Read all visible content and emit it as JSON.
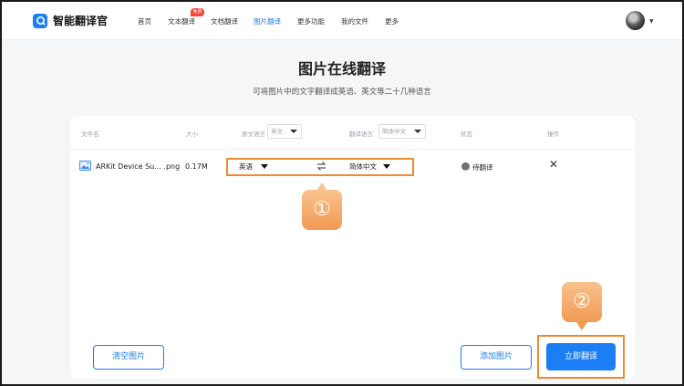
{
  "header": {
    "logo_text": "智能翻译官",
    "nav": [
      {
        "label": "首页",
        "active": false
      },
      {
        "label": "文本翻译",
        "active": false
      },
      {
        "label": "文档翻译",
        "active": false
      },
      {
        "label": "图片翻译",
        "active": true
      },
      {
        "label": "更多功能",
        "active": false
      },
      {
        "label": "我的文件",
        "active": false
      },
      {
        "label": "更多",
        "active": false
      }
    ],
    "badge": "免费",
    "accent": "#1b7ef5"
  },
  "page": {
    "title": "图片在线翻译",
    "subtitle": "可将图片中的文字翻译成英语、英文等二十几种语言"
  },
  "table": {
    "headers": {
      "file_name": "文件名",
      "size": "大小",
      "source_lang": "原文语言",
      "source_select": "英文",
      "target_lang": "翻译语言",
      "target_select": "简体中文",
      "status": "状态",
      "action": "操作"
    },
    "rows": [
      {
        "file_name": "ARKit Device Su... .png",
        "size": "0.17M",
        "source": "英语",
        "target": "简体中文",
        "status": "待翻译"
      }
    ]
  },
  "buttons": {
    "clear": "清空图片",
    "add": "添加图片",
    "translate": "立即翻译"
  },
  "annotations": {
    "step1": "①",
    "step2": "②",
    "color": "#f08a30"
  },
  "icons": [
    "logo-icon",
    "avatar",
    "image-file-icon",
    "swap-icon",
    "status-icon",
    "close-icon"
  ]
}
